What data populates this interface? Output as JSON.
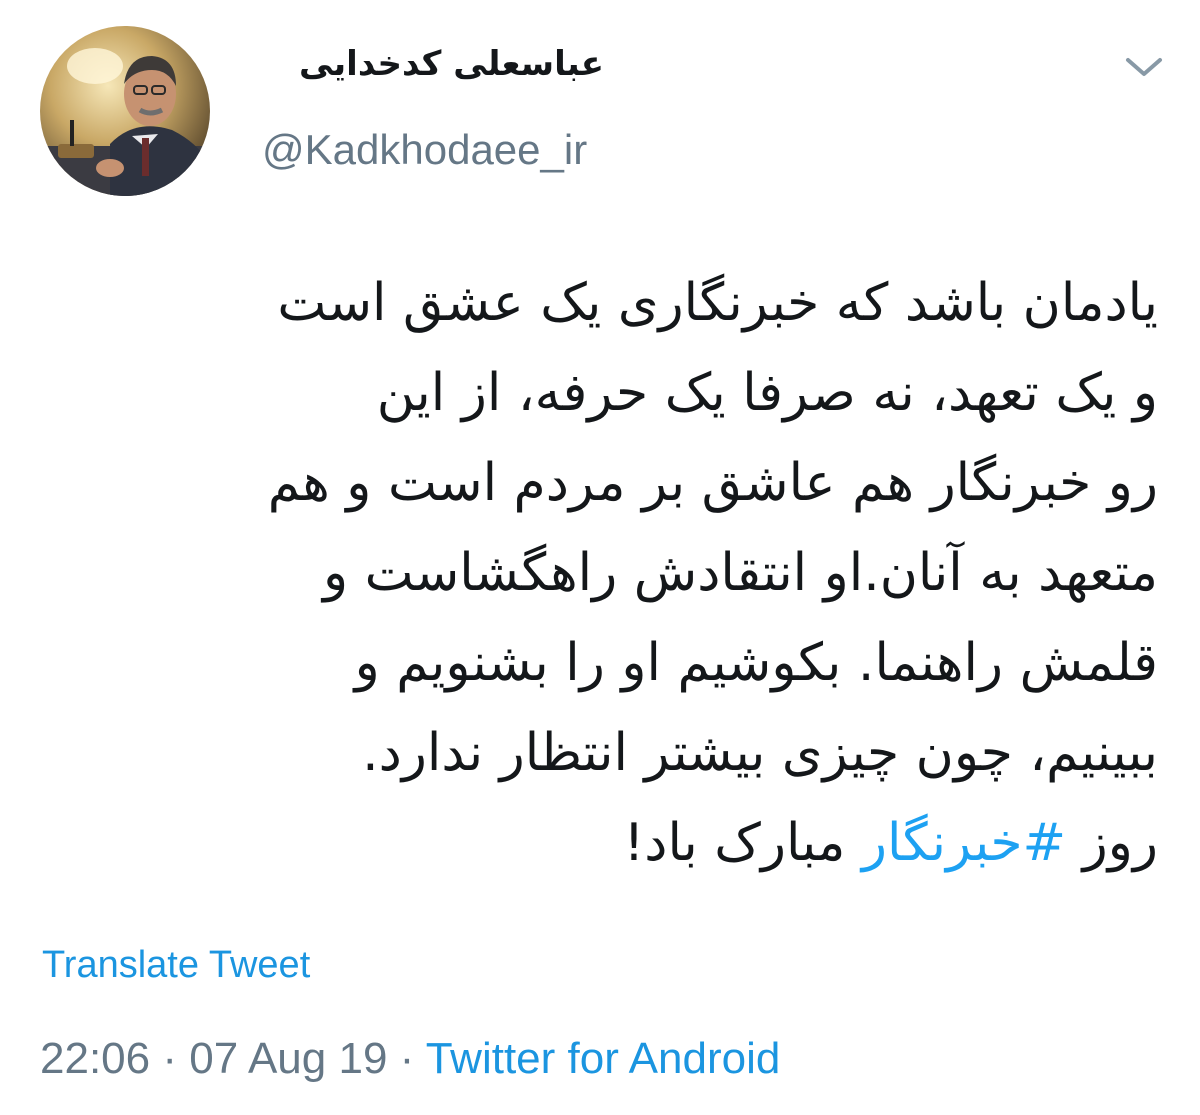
{
  "author": {
    "display_name": "عباسعلی کدخدایی",
    "handle": "@Kadkhodaee_ir"
  },
  "tweet": {
    "lines": [
      "یادمان باشد که خبرنگاری یک عشق است",
      "و  یک تعهد، نه صرفا یک حرفه، از این",
      "رو خبرنگار هم عاشق بر مردم است و هم",
      "متعهد به آنان.او انتقادش راهگشاست و",
      "قلمش راهنما. بکوشیم او را بشنویم و",
      "ببینیم، چون چیزی بیشتر انتظار ندارد."
    ],
    "last_line": {
      "before": "روز ",
      "hashtag": "#خبرنگار",
      "after": " مبارک باد!"
    }
  },
  "actions": {
    "translate_label": "Translate Tweet",
    "menu_icon": "chevron-down-icon"
  },
  "meta": {
    "time": "22:06",
    "separator1": " · ",
    "date": "07 Aug 19",
    "separator2": " · ",
    "source": "Twitter for Android"
  },
  "colors": {
    "link": "#1da1f2",
    "muted": "#657786",
    "text": "#14171a"
  }
}
